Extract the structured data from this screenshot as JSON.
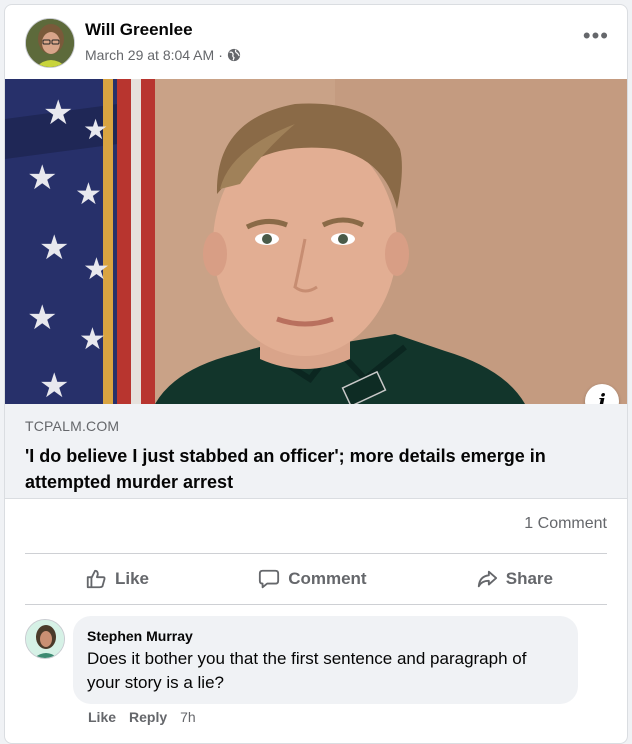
{
  "post": {
    "author": "Will Greenlee",
    "date": "March 29 at 8:04 AM",
    "separator": "·",
    "privacy_icon": "globe-icon",
    "more_label": "•••"
  },
  "link": {
    "domain": "TCPALM.COM",
    "headline": "'I do believe I just stabbed an officer'; more details emerge in attempted murder arrest",
    "info_label": "i"
  },
  "stats": {
    "comments": "1 Comment"
  },
  "actions": {
    "like": "Like",
    "comment": "Comment",
    "share": "Share"
  },
  "comment": {
    "author": "Stephen Murray",
    "text": "Does it bother you that the first sentence and paragraph of your story is a lie?",
    "like": "Like",
    "reply": "Reply",
    "time": "7h"
  },
  "colors": {
    "secondary_text": "#65676b",
    "link_box": "#f0f2f5",
    "background": "#ffffff"
  }
}
